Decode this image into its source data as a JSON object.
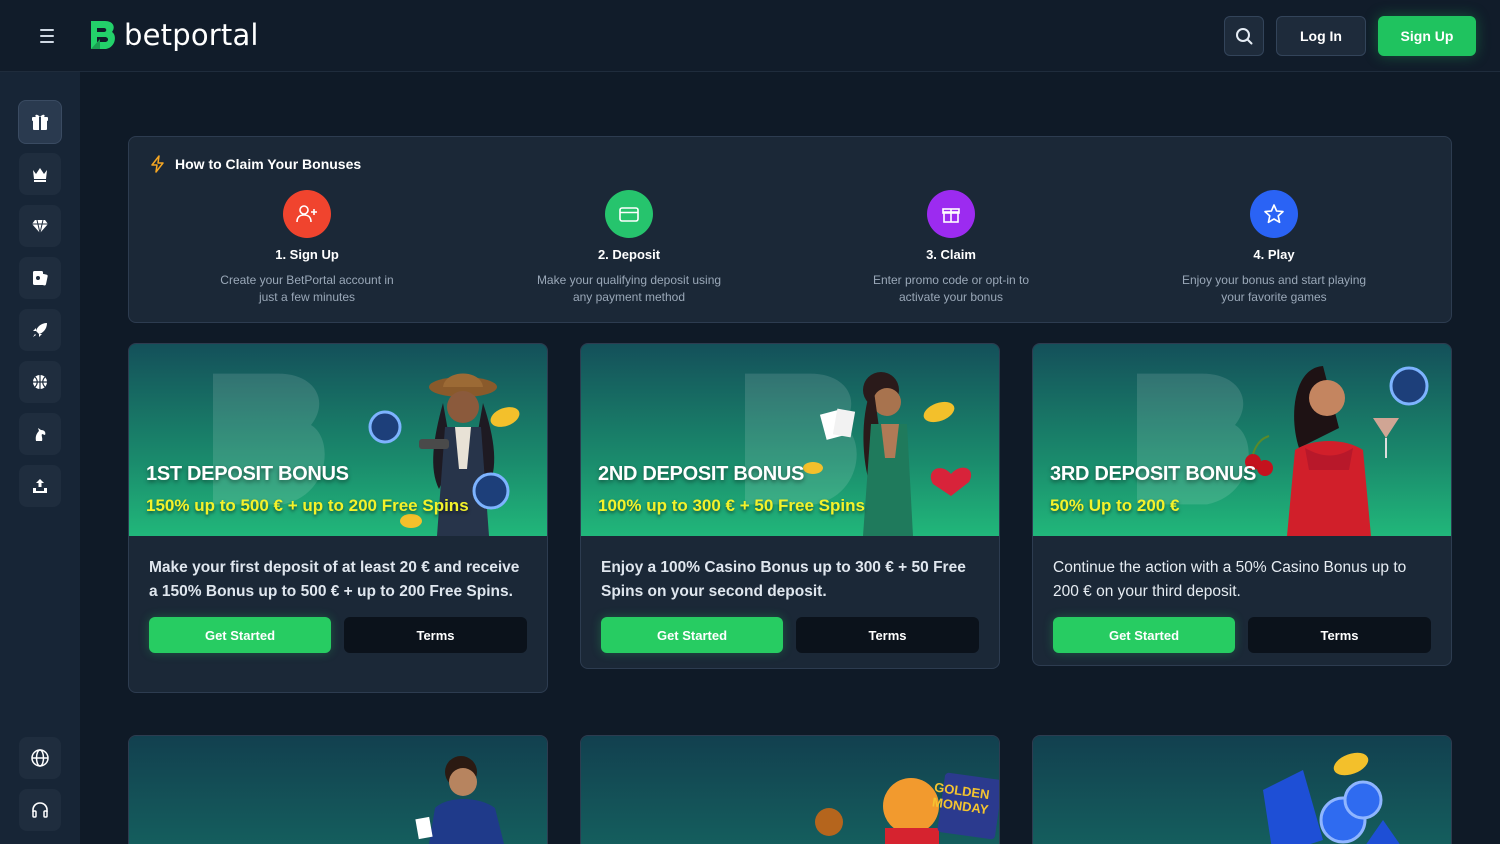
{
  "header": {
    "brand": "betportal",
    "login_label": "Log In",
    "signup_label": "Sign Up"
  },
  "sidebar": {
    "items": [
      {
        "icon": "gift-icon",
        "active": true
      },
      {
        "icon": "crown-icon"
      },
      {
        "icon": "diamond-icon"
      },
      {
        "icon": "cards-icon"
      },
      {
        "icon": "rocket-icon"
      },
      {
        "icon": "basketball-icon"
      },
      {
        "icon": "horse-icon"
      },
      {
        "icon": "user-upload-icon"
      }
    ],
    "bottom_items": [
      {
        "icon": "globe-icon"
      },
      {
        "icon": "headset-icon"
      }
    ]
  },
  "claim": {
    "title": "How to Claim Your Bonuses",
    "steps": [
      {
        "title": "1. Sign Up",
        "desc_line1": "Create your BetPortal account in",
        "desc_line2": "just a few minutes",
        "color": "#f0442e",
        "icon": "user-plus-icon"
      },
      {
        "title": "2. Deposit",
        "desc_line1": "Make your qualifying deposit using",
        "desc_line2": "any payment method",
        "color": "#26c46d",
        "icon": "credit-card-icon"
      },
      {
        "title": "3. Claim",
        "desc_line1": "Enter promo code or opt-in to",
        "desc_line2": "activate your bonus",
        "color": "#9c2bf0",
        "icon": "gift-box-icon"
      },
      {
        "title": "4. Play",
        "desc_line1": "Enjoy your bonus and start playing",
        "desc_line2": "your favorite games",
        "color": "#2a63f5",
        "icon": "star-icon"
      }
    ]
  },
  "cards": [
    {
      "banner_title": "1ST DEPOSIT BONUS",
      "banner_sub": "150% up to 500 € + up to 200 Free Spins",
      "desc": "Make your first deposit of at least 20 € and receive a 150% Bonus up to 500 € + up to 200 Free Spins.",
      "start_label": "Get Started",
      "terms_label": "Terms"
    },
    {
      "banner_title": "2ND DEPOSIT BONUS",
      "banner_sub": "100% up to 300 € + 50 Free Spins",
      "desc": "Enjoy a 100% Casino Bonus up to 300 € + 50 Free Spins on your second deposit.",
      "start_label": "Get Started",
      "terms_label": "Terms"
    },
    {
      "banner_title": "3RD DEPOSIT BONUS",
      "banner_sub": "50% Up to 200 €",
      "desc": "Continue the action with a 50% Casino Bonus up to 200 € on your third deposit.",
      "start_label": "Get Started",
      "terms_label": "Terms"
    }
  ],
  "bottom_cards": {
    "golden_monday_text": "GOLDEN MONDAY"
  },
  "colors": {
    "accent_green": "#27cc62",
    "highlight_yellow": "#f4f22a",
    "background": "#0f1a27"
  }
}
